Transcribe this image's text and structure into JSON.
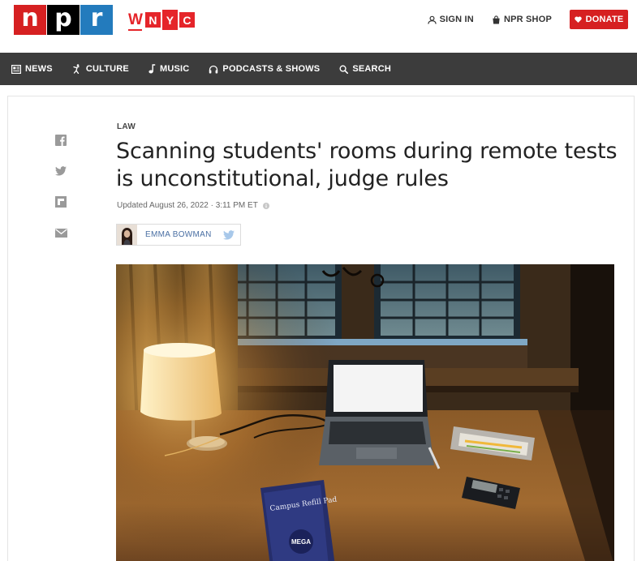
{
  "header": {
    "npr_letters": [
      "n",
      "p",
      "r"
    ],
    "wnyc_letters": [
      "W",
      "N",
      "Y",
      "C"
    ],
    "sign_in": "SIGN IN",
    "shop": "NPR SHOP",
    "donate": "DONATE"
  },
  "nav": {
    "items": [
      {
        "label": "NEWS",
        "icon": "news-icon"
      },
      {
        "label": "CULTURE",
        "icon": "culture-icon"
      },
      {
        "label": "MUSIC",
        "icon": "music-note-icon"
      },
      {
        "label": "PODCASTS & SHOWS",
        "icon": "headphones-icon"
      },
      {
        "label": "SEARCH",
        "icon": "search-icon"
      }
    ]
  },
  "article": {
    "kicker": "LAW",
    "headline": "Scanning students' rooms during remote tests is unconstitutional, judge rules",
    "updated": "Updated August 26, 2022 · 3:11 PM ET",
    "author": "EMMA BOWMAN",
    "book_cover": {
      "title": "Campus Refill Pad",
      "brand": "MEGA"
    }
  },
  "share": [
    "facebook-icon",
    "twitter-icon",
    "flipboard-icon",
    "email-icon"
  ],
  "colors": {
    "npr_red": "#d62021",
    "npr_black": "#000000",
    "npr_blue": "#237bbd",
    "wnyc_red": "#e5252a",
    "nav_bg": "#3c3c3c",
    "byline_link": "#4a6fa3"
  }
}
